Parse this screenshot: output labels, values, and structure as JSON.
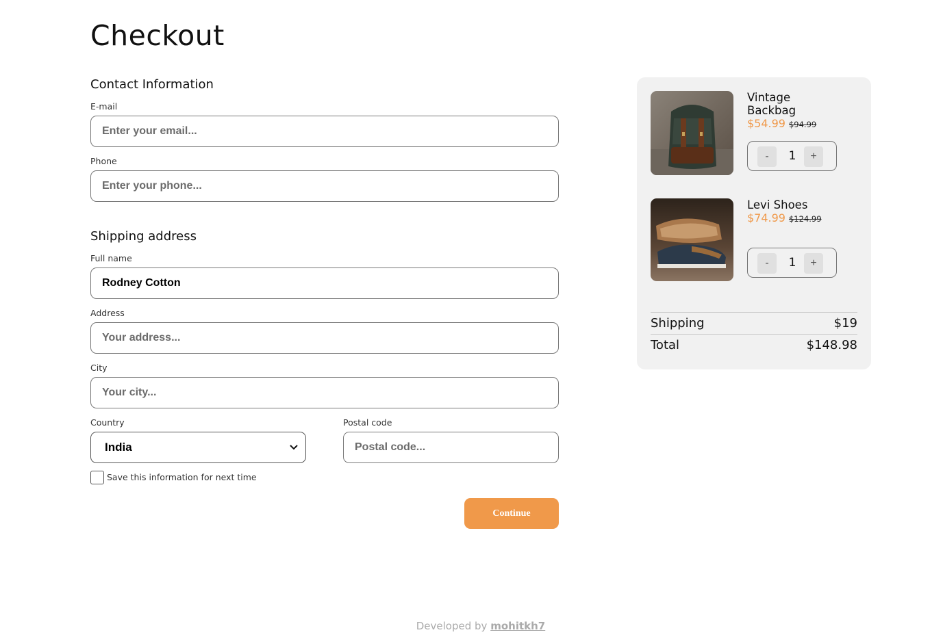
{
  "page": {
    "title": "Checkout"
  },
  "contact": {
    "heading": "Contact Information",
    "email": {
      "label": "E-mail",
      "placeholder": "Enter your email...",
      "value": ""
    },
    "phone": {
      "label": "Phone",
      "placeholder": "Enter your phone...",
      "value": ""
    }
  },
  "shipping": {
    "heading": "Shipping address",
    "full_name": {
      "label": "Full name",
      "placeholder": "",
      "value": "Rodney Cotton"
    },
    "address": {
      "label": "Address",
      "placeholder": "Your address...",
      "value": ""
    },
    "city": {
      "label": "City",
      "placeholder": "Your city...",
      "value": ""
    },
    "country": {
      "label": "Country",
      "selected": "India"
    },
    "postal": {
      "label": "Postal code",
      "placeholder": "Postal code...",
      "value": ""
    },
    "save_info_label": "Save this information for next time",
    "save_info_checked": false
  },
  "actions": {
    "continue_label": "Continue"
  },
  "cart": {
    "items": [
      {
        "name": "Vintage Backbag",
        "price": "$54.99",
        "old_price": "$94.99",
        "quantity": "1",
        "image": "backpack-photo"
      },
      {
        "name": "Levi Shoes",
        "price": "$74.99",
        "old_price": "$124.99",
        "quantity": "1",
        "image": "shoes-photo"
      }
    ],
    "minus_label": "-",
    "plus_label": "+",
    "shipping_label": "Shipping",
    "shipping_value": "$19",
    "total_label": "Total",
    "total_value": "$148.98"
  },
  "footer": {
    "prefix": "Developed by",
    "author": "mohitkh7"
  },
  "colors": {
    "accent": "#f0994a",
    "cart_bg": "#f1f1f1",
    "border": "#777777"
  }
}
